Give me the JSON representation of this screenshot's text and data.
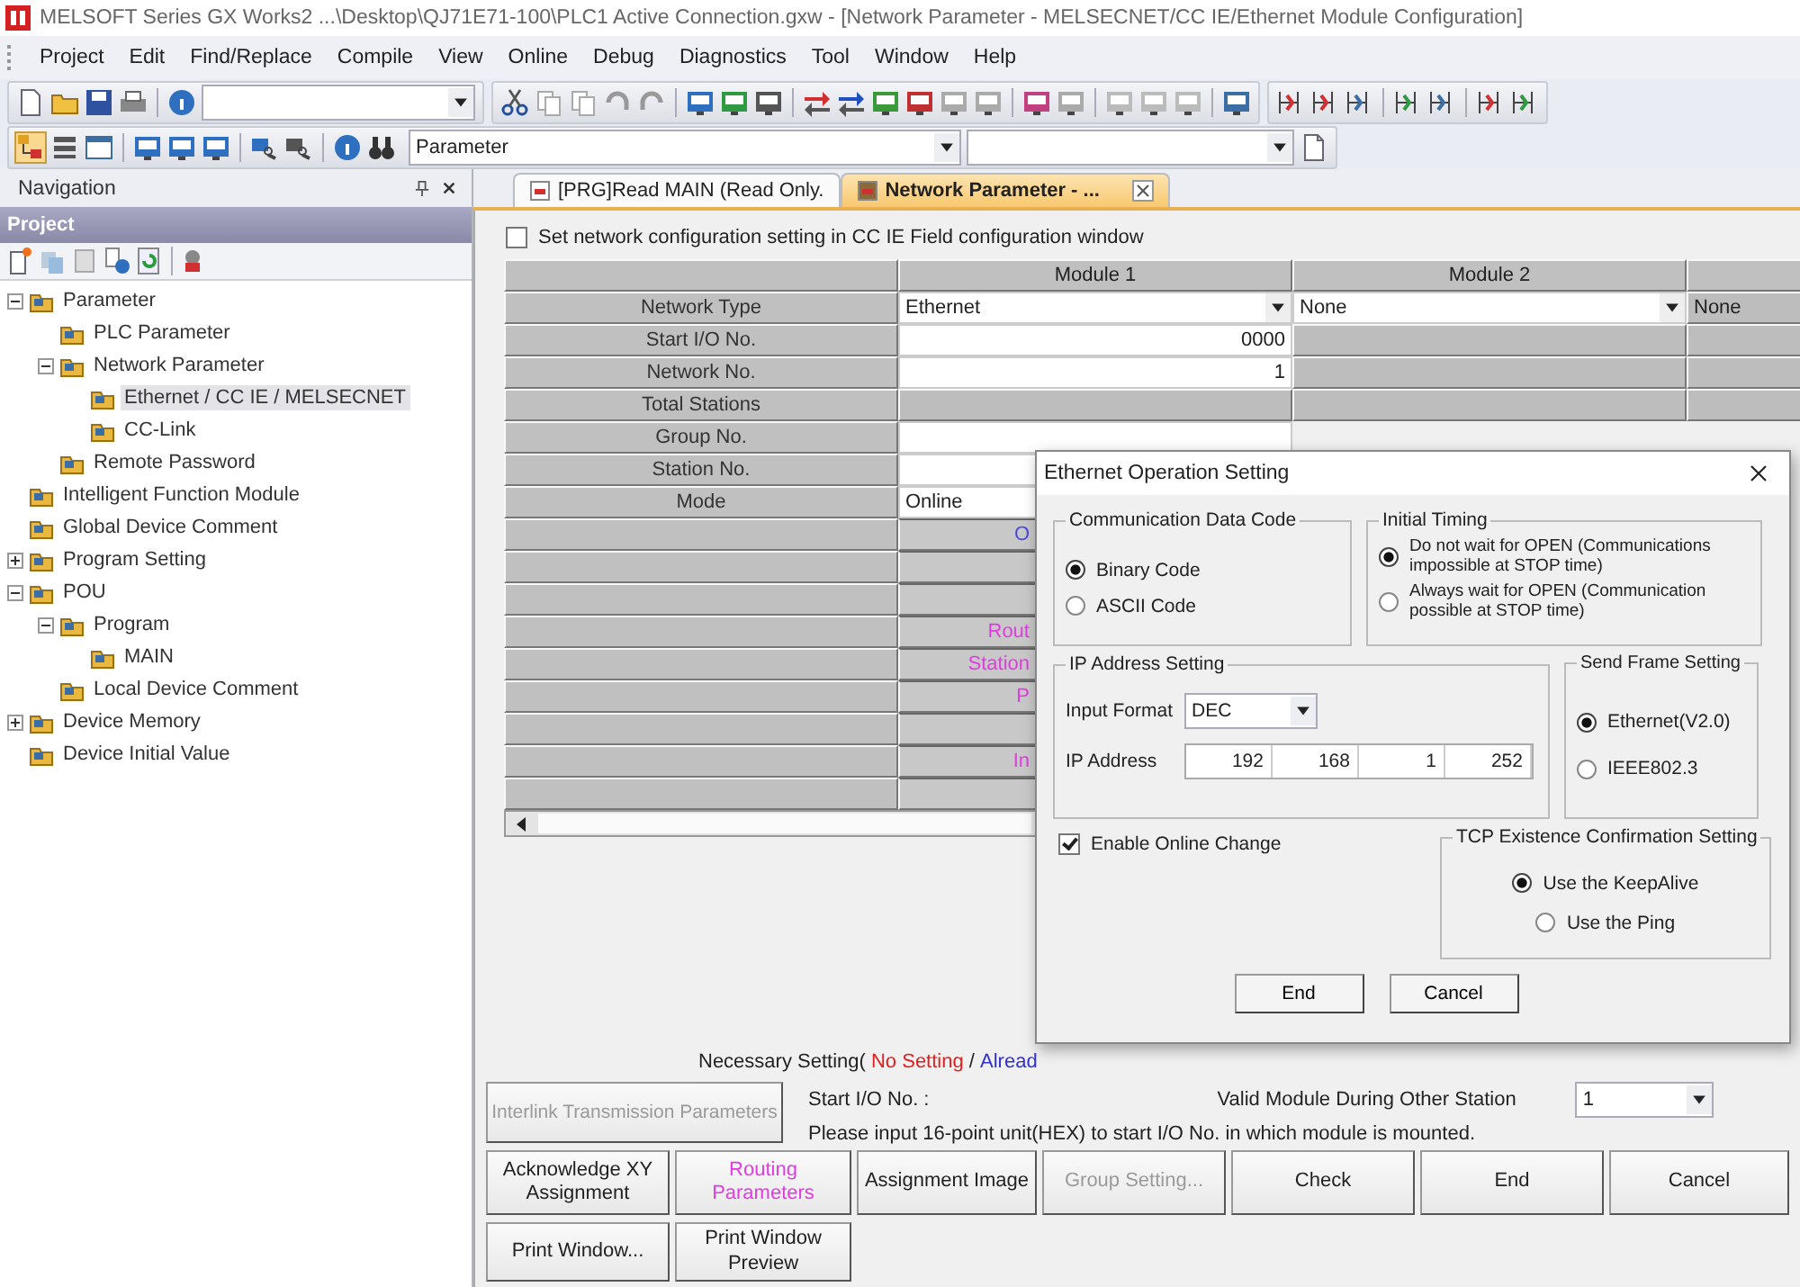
{
  "window": {
    "title": "MELSOFT Series GX Works2 ...\\Desktop\\QJ71E71-100\\PLC1 Active Connection.gxw - [Network Parameter - MELSECNET/CC IE/Ethernet Module Configuration]"
  },
  "menu": [
    "Project",
    "Edit",
    "Find/Replace",
    "Compile",
    "View",
    "Online",
    "Debug",
    "Diagnostics",
    "Tool",
    "Window",
    "Help"
  ],
  "toolbar": {
    "combo": "Parameter"
  },
  "navigation": {
    "title": "Navigation",
    "section": "Project",
    "tree": [
      {
        "label": "Parameter",
        "expanded": true,
        "selected": false,
        "children": [
          {
            "label": "PLC Parameter",
            "selected": false
          },
          {
            "label": "Network Parameter",
            "expanded": true,
            "selected": false,
            "children": [
              {
                "label": "Ethernet / CC IE / MELSECNET",
                "selected": true
              },
              {
                "label": "CC-Link",
                "selected": false
              }
            ]
          },
          {
            "label": "Remote Password",
            "selected": false
          }
        ]
      },
      {
        "label": "Intelligent Function Module",
        "selected": false
      },
      {
        "label": "Global Device Comment",
        "selected": false
      },
      {
        "label": "Program Setting",
        "expanded": false,
        "selected": false
      },
      {
        "label": "POU",
        "expanded": true,
        "selected": false,
        "children": [
          {
            "label": "Program",
            "expanded": true,
            "selected": false,
            "children": [
              {
                "label": "MAIN",
                "selected": false
              }
            ]
          },
          {
            "label": "Local Device Comment",
            "selected": false
          }
        ]
      },
      {
        "label": "Device Memory",
        "expanded": false,
        "selected": false
      },
      {
        "label": "Device Initial Value",
        "selected": false
      }
    ]
  },
  "tabs": [
    {
      "label": "[PRG]Read MAIN (Read Only.",
      "selected": false
    },
    {
      "label": "Network Parameter - ...",
      "selected": true
    }
  ],
  "config_checkbox": {
    "label": "Set network configuration setting in CC IE Field configuration window",
    "checked": false
  },
  "table": {
    "columns": [
      "Module 1",
      "Module 2"
    ],
    "rows": [
      {
        "label": "Network Type",
        "cells": [
          {
            "kind": "dropdown",
            "value": "Ethernet"
          },
          {
            "kind": "dropdown",
            "value": "None"
          },
          {
            "kind": "text",
            "value": "None"
          }
        ]
      },
      {
        "label": "Start I/O No.",
        "cells": [
          {
            "kind": "input",
            "value": "0000"
          }
        ]
      },
      {
        "label": "Network No.",
        "cells": [
          {
            "kind": "input",
            "value": "1"
          }
        ]
      },
      {
        "label": "Total Stations",
        "cells": [
          {
            "kind": "grey"
          }
        ]
      },
      {
        "label": "Group No.",
        "cells": [
          {
            "kind": "input"
          }
        ]
      },
      {
        "label": "Station No.",
        "cells": [
          {
            "kind": "input"
          }
        ]
      },
      {
        "label": "Mode",
        "cells": [
          {
            "kind": "choice",
            "value": "Online"
          }
        ]
      },
      {
        "cells": [
          {
            "kind": "note",
            "value": "O",
            "color": "#4a4ae0"
          }
        ]
      },
      {
        "cells": [
          {
            "kind": "blank"
          }
        ]
      },
      {
        "cells": [
          {
            "kind": "blank"
          }
        ]
      },
      {
        "cells": [
          {
            "kind": "note",
            "value": "Rout",
            "color": "#e03ce0"
          }
        ]
      },
      {
        "cells": [
          {
            "kind": "note",
            "value": "Station",
            "color": "#e03ce0"
          }
        ]
      },
      {
        "cells": [
          {
            "kind": "note",
            "value": "P",
            "color": "#e03ce0"
          }
        ]
      },
      {
        "cells": [
          {
            "kind": "blank"
          }
        ]
      },
      {
        "cells": [
          {
            "kind": "note",
            "value": "In",
            "color": "#e03ce0"
          }
        ]
      },
      {
        "cells": [
          {
            "kind": "blank"
          }
        ]
      }
    ]
  },
  "necessary": {
    "prefix": "Necessary Setting(",
    "no_setting": "No Setting",
    "separator": "/",
    "already": "Alread"
  },
  "interlink_button": {
    "label": "Interlink Transmission Parameters",
    "disabled": true
  },
  "start_io_label": "Start I/O No. :",
  "valid_module": {
    "label": "Valid Module During Other Station",
    "value": "1"
  },
  "hint": "Please input 16-point unit(HEX) to start I/O No. in which module is mounted.",
  "buttons": [
    {
      "label": "Acknowledge XY Assignment",
      "disabled": false,
      "accent": false
    },
    {
      "label": "Routing Parameters",
      "disabled": false,
      "accent": true
    },
    {
      "label": "Assignment Image",
      "disabled": false,
      "accent": false
    },
    {
      "label": "Group Setting...",
      "disabled": true,
      "accent": false
    },
    {
      "label": "Check",
      "disabled": false,
      "accent": false
    },
    {
      "label": "End",
      "disabled": false,
      "accent": false
    },
    {
      "label": "Cancel",
      "disabled": false,
      "accent": false
    },
    {
      "label": "Print Window...",
      "disabled": false,
      "accent": false
    },
    {
      "label": "Print Window Preview",
      "disabled": false,
      "accent": false
    }
  ],
  "dialog": {
    "title": "Ethernet Operation Setting",
    "data_code": {
      "title": "Communication Data Code",
      "options": [
        {
          "label": "Binary Code",
          "selected": true
        },
        {
          "label": "ASCII Code",
          "selected": false
        }
      ]
    },
    "initial_timing": {
      "title": "Initial Timing",
      "options": [
        {
          "label": "Do not wait for OPEN (Communications impossible at STOP time)",
          "selected": true
        },
        {
          "label": "Always wait for OPEN (Communication possible at STOP time)",
          "selected": false
        }
      ]
    },
    "ip_setting": {
      "title": "IP Address Setting",
      "input_format_label": "Input Format",
      "input_format": "DEC",
      "ip_label": "IP Address",
      "ip": [
        "192",
        "168",
        "1",
        "252"
      ]
    },
    "send_frame": {
      "title": "Send Frame Setting",
      "options": [
        {
          "label": "Ethernet(V2.0)",
          "selected": true
        },
        {
          "label": "IEEE802.3",
          "selected": false
        }
      ]
    },
    "online_change": {
      "label": "Enable Online Change",
      "checked": true
    },
    "tcp": {
      "title": "TCP Existence Confirmation Setting",
      "options": [
        {
          "label": "Use the KeepAlive",
          "selected": true
        },
        {
          "label": "Use the Ping",
          "selected": false
        }
      ]
    },
    "buttons": [
      "End",
      "Cancel"
    ]
  }
}
